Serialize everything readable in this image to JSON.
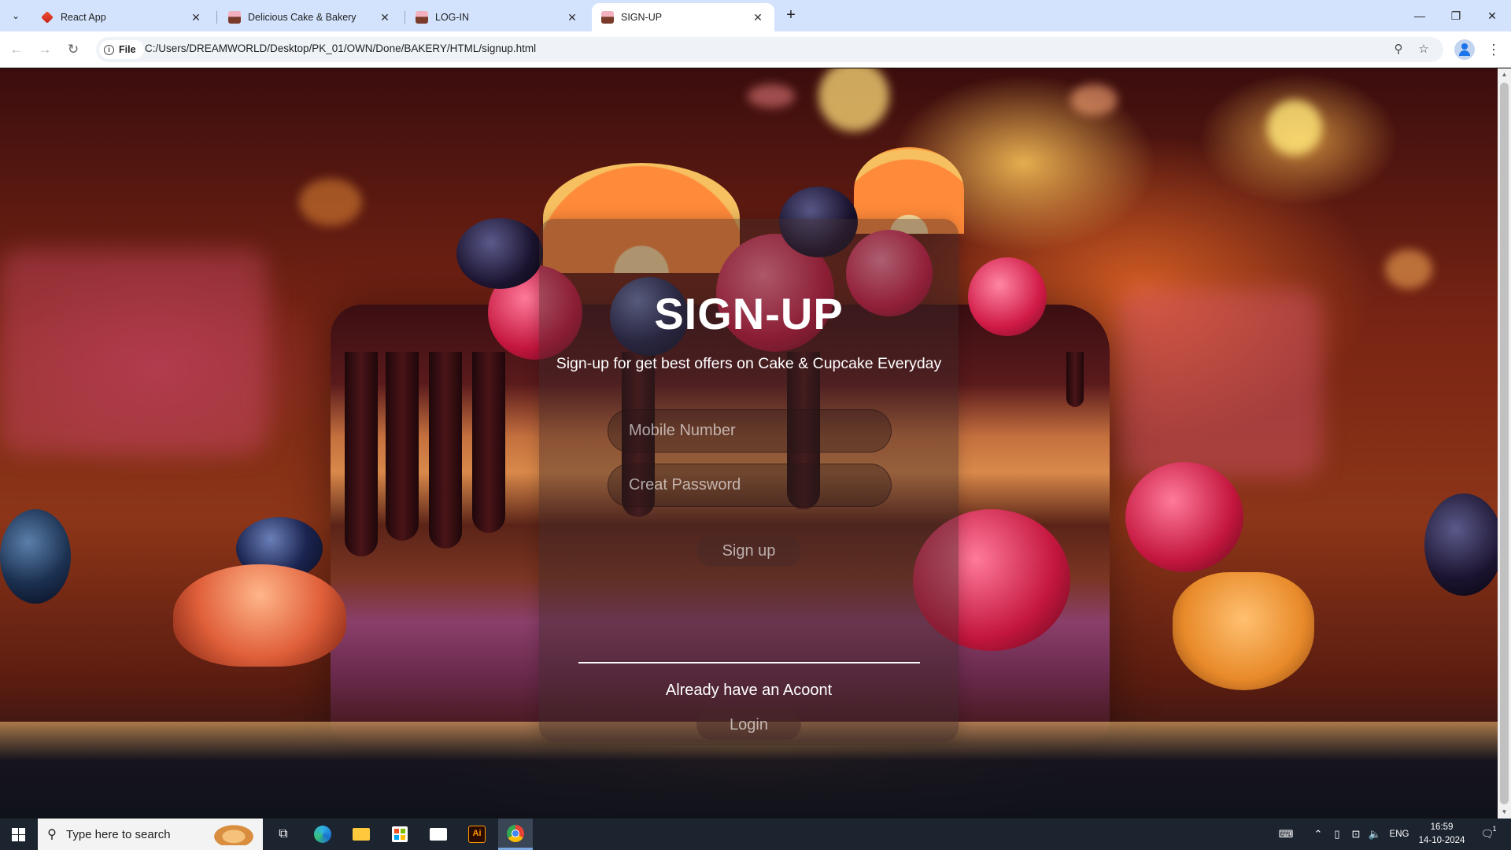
{
  "browser": {
    "tabs": [
      {
        "title": "React App",
        "active": false
      },
      {
        "title": "Delicious Cake & Bakery",
        "active": false
      },
      {
        "title": "LOG-IN",
        "active": false
      },
      {
        "title": "SIGN-UP",
        "active": true
      }
    ],
    "url_scheme_label": "File",
    "url": "C:/Users/DREAMWORLD/Desktop/PK_01/OWN/Done/BAKERY/HTML/signup.html"
  },
  "page": {
    "title": "SIGN-UP",
    "subtitle": "Sign-up for get best offers on Cake & Cupcake Everyday",
    "mobile_placeholder": "Mobile Number",
    "password_placeholder": "Creat Password",
    "signup_label": "Sign up",
    "already_text": "Already have an Acoont",
    "login_label": "Login"
  },
  "taskbar": {
    "search_placeholder": "Type here to search",
    "language": "ENG",
    "time": "16:59",
    "date": "14-10-2024",
    "notification_count": "1"
  },
  "colors": {
    "tab_strip": "#d3e3fd",
    "taskbar": "#1c2430",
    "card_text": "#ffffff"
  }
}
